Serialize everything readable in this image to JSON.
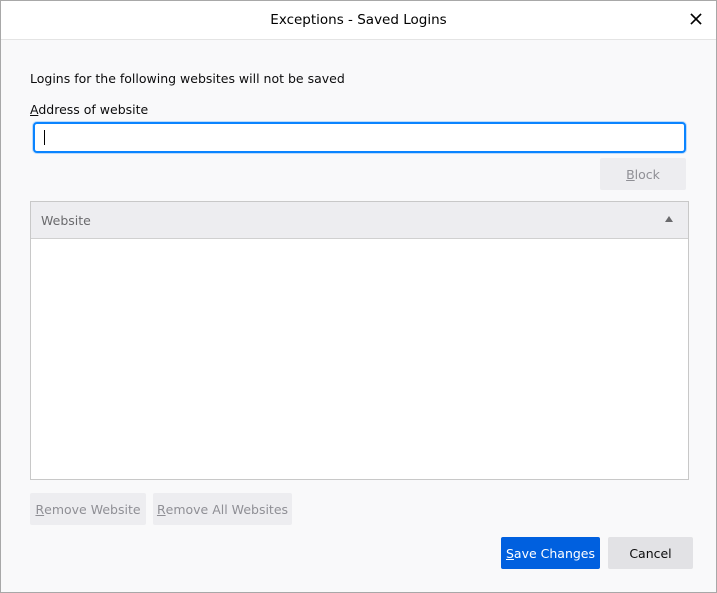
{
  "window": {
    "title": "Exceptions - Saved Logins",
    "close_icon": "close-icon"
  },
  "intro_text": "Logins for the following websites will not be saved",
  "address": {
    "label_access_key": "A",
    "label_rest": "ddress of website",
    "value": ""
  },
  "buttons": {
    "block_key": "B",
    "block_rest": "lock",
    "remove_key": "R",
    "remove_rest": "emove Website",
    "remove_all_key": "R",
    "remove_all_rest": "emove All Websites",
    "save_key": "S",
    "save_rest": "ave Changes",
    "cancel": "Cancel"
  },
  "table": {
    "columns": [
      {
        "label": "Website",
        "sort": "ascending"
      }
    ],
    "rows": []
  },
  "colors": {
    "accent": "#0a84ff",
    "primary_button": "#0060df",
    "disabled_button": "#ededf0",
    "disabled_text": "#8f8f95"
  }
}
